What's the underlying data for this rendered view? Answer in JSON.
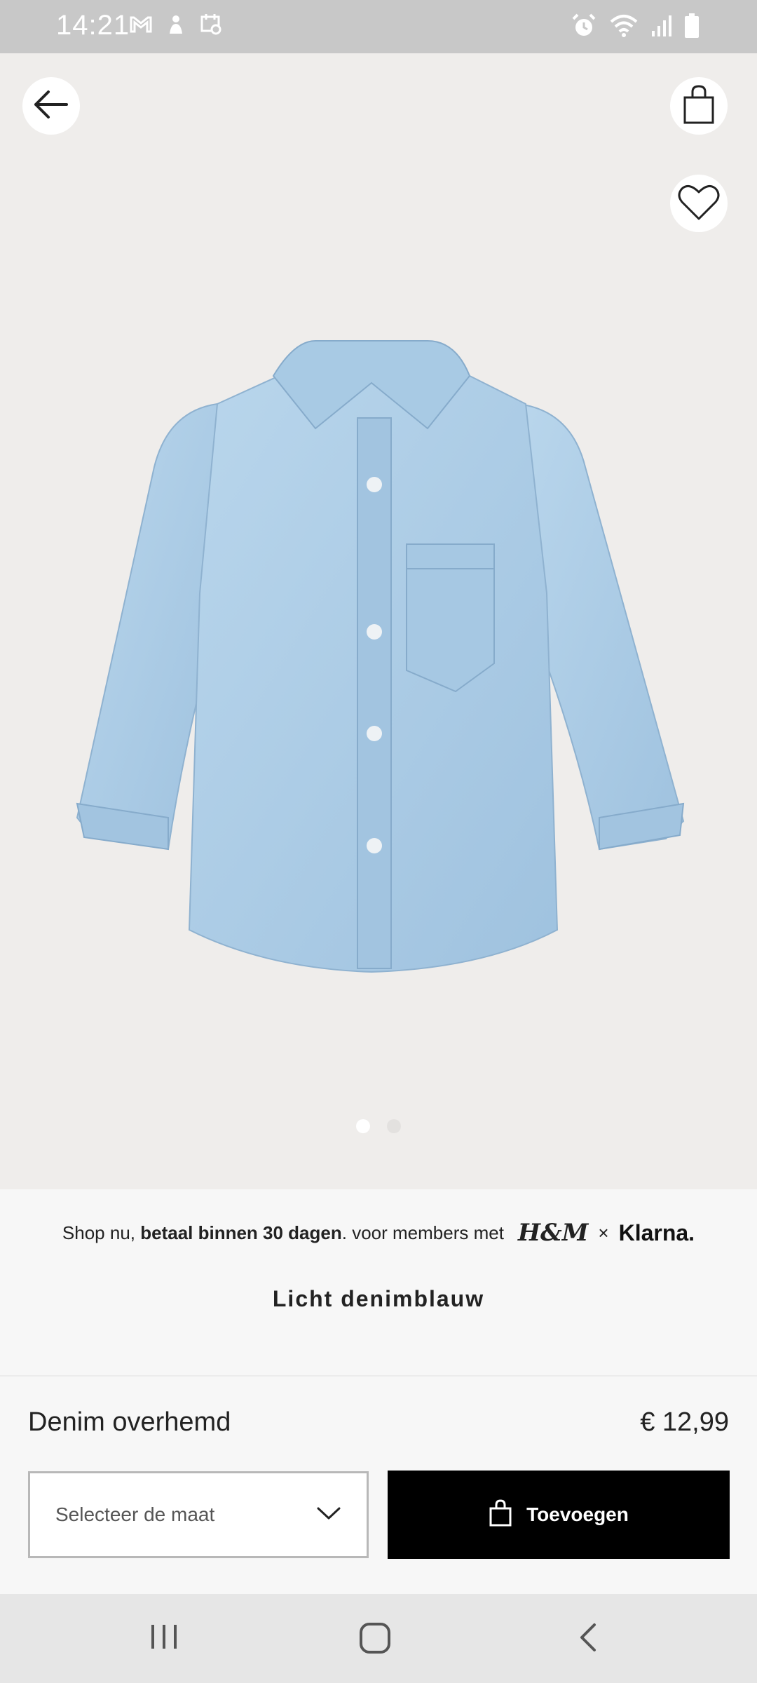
{
  "status_bar": {
    "time": "14:21",
    "left_icons": [
      "gmail-icon",
      "notification-icon",
      "calendar-icon"
    ],
    "right_icons": [
      "alarm-icon",
      "wifi-icon",
      "signal-icon",
      "battery-icon"
    ]
  },
  "header": {
    "back_icon": "arrow-left-icon",
    "bag_icon": "shopping-bag-icon",
    "favorite_icon": "heart-icon"
  },
  "gallery": {
    "image_description_name": "product-image",
    "page_count": 2,
    "active_page": 1
  },
  "promo": {
    "prefix": "Shop nu, ",
    "emphasis": "betaal binnen 30 dagen",
    "suffix": ". voor members met",
    "brand_1": "H&M",
    "separator": "×",
    "brand_2": "Klarna."
  },
  "product": {
    "color": "Licht denimblauw",
    "name": "Denim overhemd",
    "price": "€ 12,99"
  },
  "actions": {
    "size_placeholder": "Selecteer de maat",
    "add_label": "Toevoegen"
  },
  "colors": {
    "status_bar": "#c8c8c8",
    "hero_bg": "#efedeb",
    "denim": "#a9c9e2",
    "button_bg": "#000000"
  }
}
